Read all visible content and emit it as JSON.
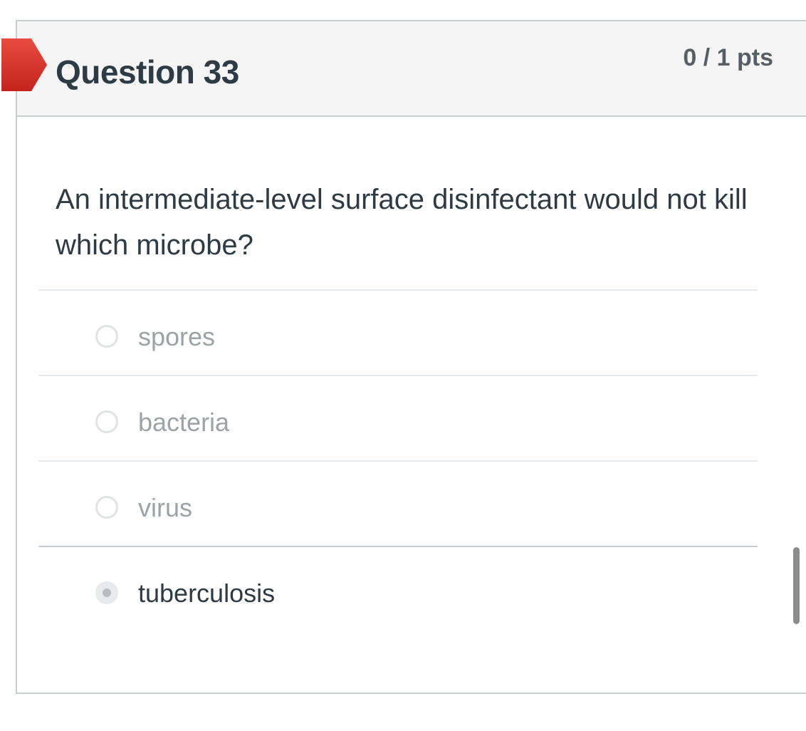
{
  "question": {
    "title": "Question 33",
    "points": "0 / 1 pts",
    "text": "An intermediate-level surface disinfectant would not kill which microbe?",
    "flag_icon": "flag-marker-icon",
    "flag_color": "#d9342b"
  },
  "answers": [
    {
      "label": "spores",
      "selected": false
    },
    {
      "label": "bacteria",
      "selected": false
    },
    {
      "label": "virus",
      "selected": false
    },
    {
      "label": "tuberculosis",
      "selected": true
    }
  ]
}
